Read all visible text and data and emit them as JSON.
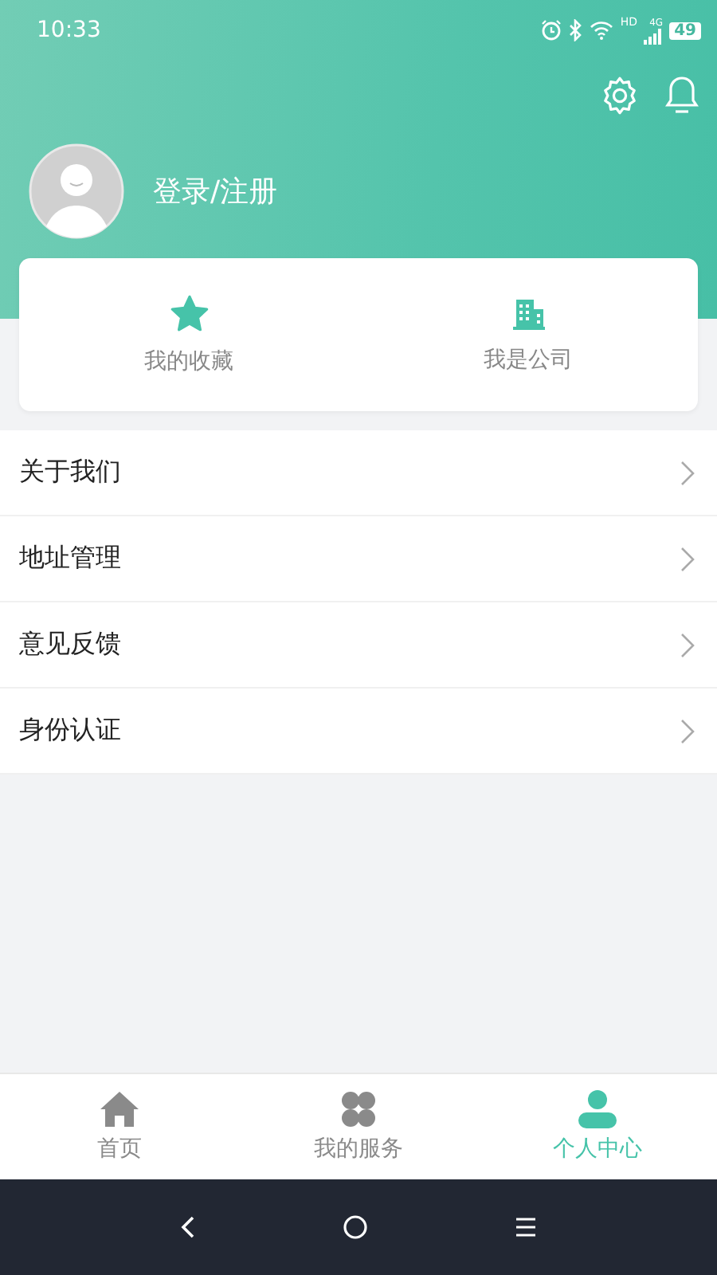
{
  "status_bar": {
    "time": "10:33",
    "network_hd": "HD",
    "network_gen": "4G",
    "battery": "49"
  },
  "profile": {
    "login_label": "登录/注册"
  },
  "quick_actions": [
    {
      "kind": "star",
      "label": "我的收藏"
    },
    {
      "kind": "building",
      "label": "我是公司"
    }
  ],
  "menu": [
    {
      "label": "关于我们"
    },
    {
      "label": "地址管理"
    },
    {
      "label": "意见反馈"
    },
    {
      "label": "身份认证"
    }
  ],
  "tabs": [
    {
      "kind": "home",
      "label": "首页",
      "selected": false
    },
    {
      "kind": "services",
      "label": "我的服务",
      "selected": false
    },
    {
      "kind": "profile",
      "label": "个人中心",
      "selected": true
    }
  ]
}
